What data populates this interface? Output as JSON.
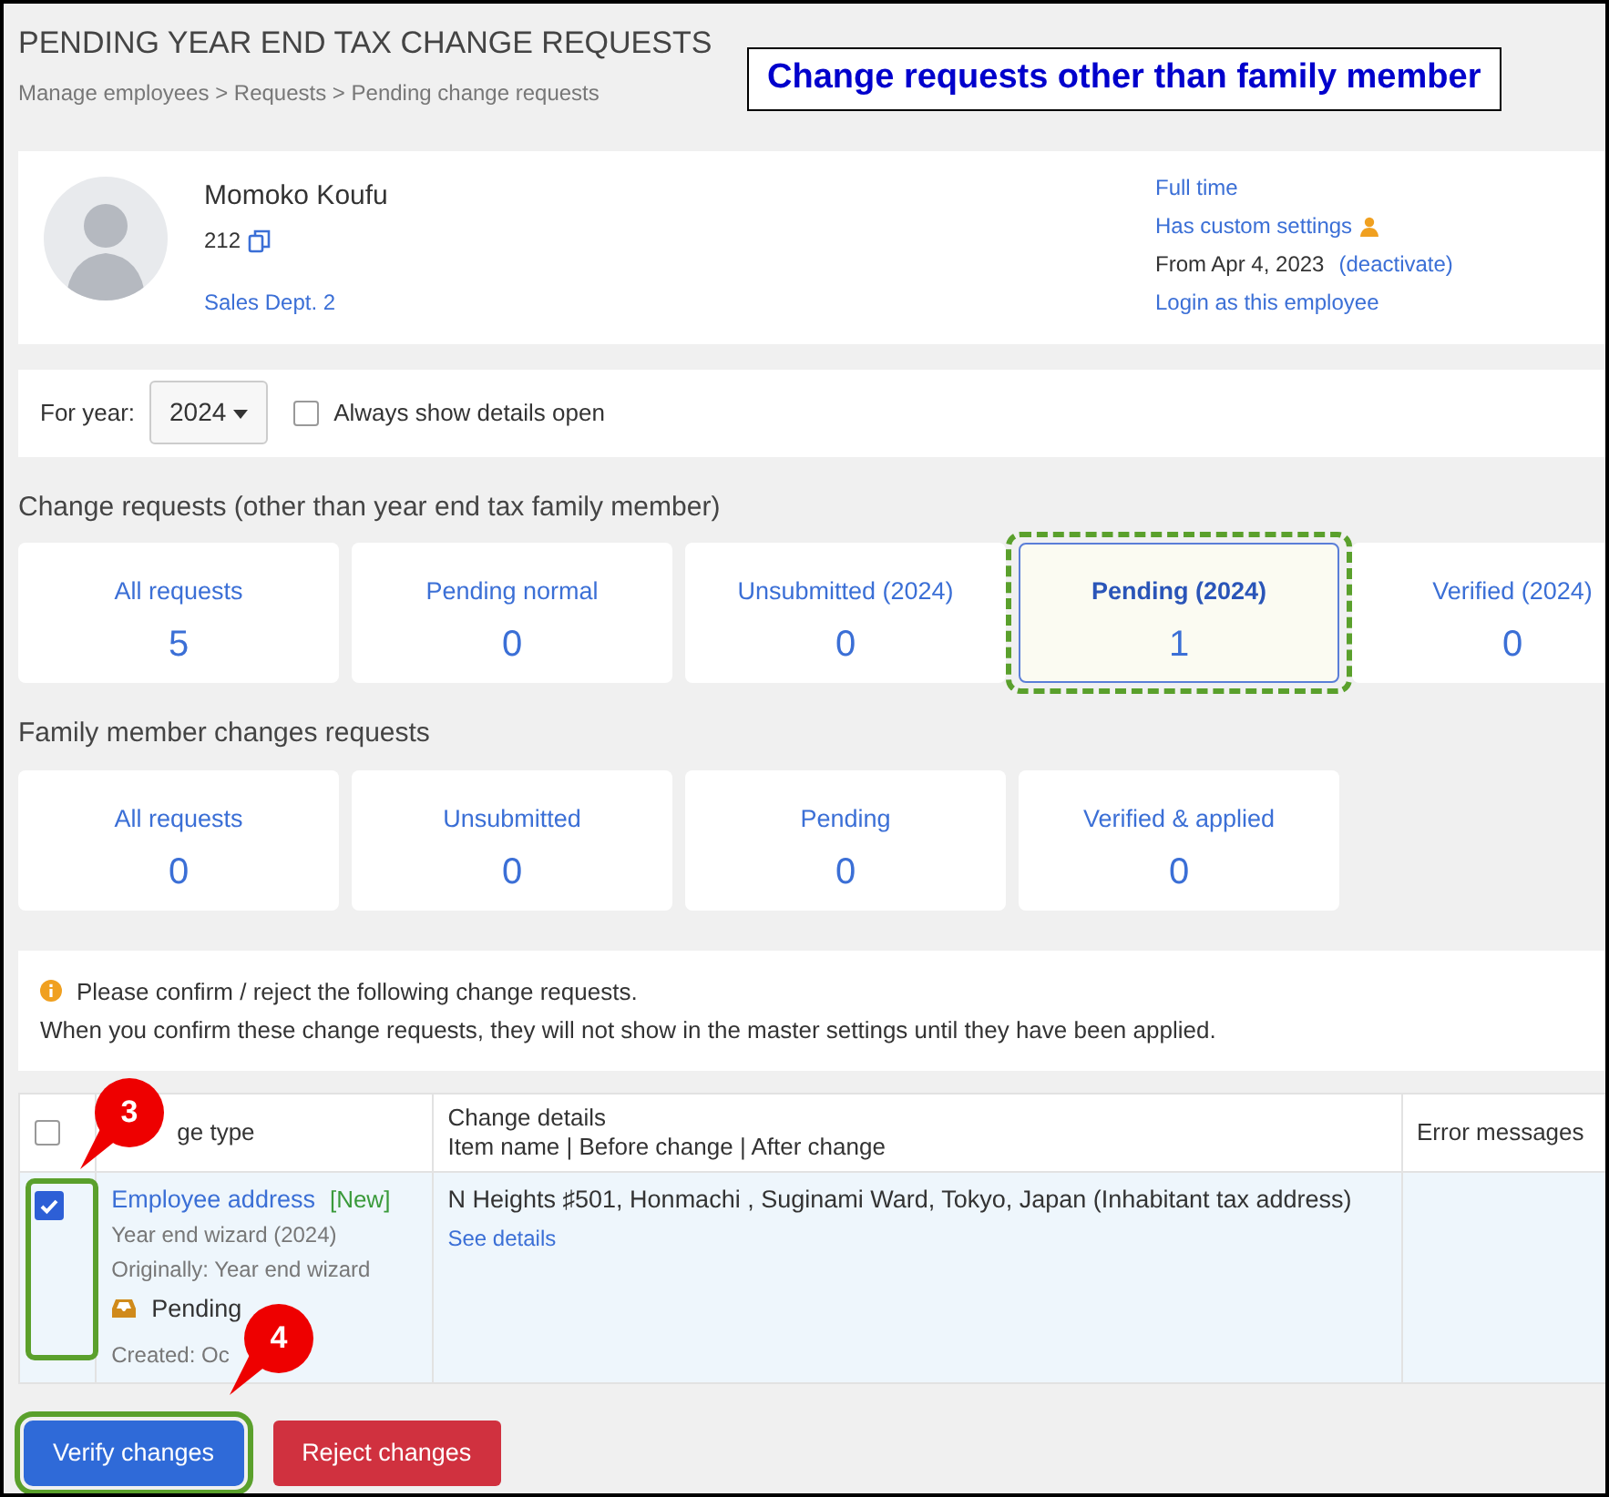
{
  "header": {
    "title": "PENDING YEAR END TAX CHANGE REQUESTS",
    "breadcrumb": "Manage employees > Requests > Pending change requests"
  },
  "annotation_label": "Change requests other than family member",
  "employee": {
    "name": "Momoko Koufu",
    "number": "212",
    "department": "Sales Dept. 2",
    "employment_type": "Full time",
    "custom_settings": "Has custom settings",
    "from_date": "From Apr 4, 2023",
    "deactivate": "(deactivate)",
    "login_link": "Login as this employee"
  },
  "filters": {
    "year_label": "For year:",
    "year": "2024",
    "always_open": {
      "label": "Always show details open",
      "checked": false
    }
  },
  "change_section": {
    "title": "Change requests (other than year end tax family member)",
    "cards": [
      {
        "label": "All requests",
        "count": "5",
        "selected": false,
        "highlighted": false
      },
      {
        "label": "Pending normal",
        "count": "0",
        "selected": false,
        "highlighted": false
      },
      {
        "label": "Unsubmitted (2024)",
        "count": "0",
        "selected": false,
        "highlighted": false
      },
      {
        "label": "Pending (2024)",
        "count": "1",
        "selected": true,
        "highlighted": true
      },
      {
        "label": "Verified (2024)",
        "count": "0",
        "selected": false,
        "highlighted": false
      }
    ]
  },
  "family_section": {
    "title": "Family member changes requests",
    "cards": [
      {
        "label": "All requests",
        "count": "0",
        "selected": false,
        "highlighted": false
      },
      {
        "label": "Unsubmitted",
        "count": "0",
        "selected": false,
        "highlighted": false
      },
      {
        "label": "Pending",
        "count": "0",
        "selected": false,
        "highlighted": false
      },
      {
        "label": "Verified & applied",
        "count": "0",
        "selected": false,
        "highlighted": false
      }
    ]
  },
  "notice": {
    "lines": [
      "Please confirm / reject the following change requests.",
      "When you confirm these change requests, they will not show in the master settings until they have been applied."
    ]
  },
  "table": {
    "select_all_checked": false,
    "columns": [
      {
        "title": "ge type"
      },
      {
        "title": "Change details",
        "subtitle": "Item name | Before change | After change"
      },
      {
        "title": "Error messages"
      }
    ],
    "rows": [
      {
        "checked": true,
        "highlighted": true,
        "type": "Employee address",
        "tag": "[New]",
        "source": "Year end wizard (2024)",
        "origin": "Originally: Year end wizard",
        "status": "Pending",
        "created": "Created: Oc",
        "details": "N Heights ♯501, Honmachi , Suginami Ward, Tokyo, Japan (Inhabitant tax address)",
        "see_details": "See details"
      }
    ]
  },
  "buttons": [
    {
      "label": "Verify changes",
      "kind": "primary",
      "highlighted": true
    },
    {
      "label": "Reject changes",
      "kind": "danger",
      "highlighted": false
    }
  ],
  "callouts": [
    {
      "number": "3"
    },
    {
      "number": "4"
    }
  ]
}
